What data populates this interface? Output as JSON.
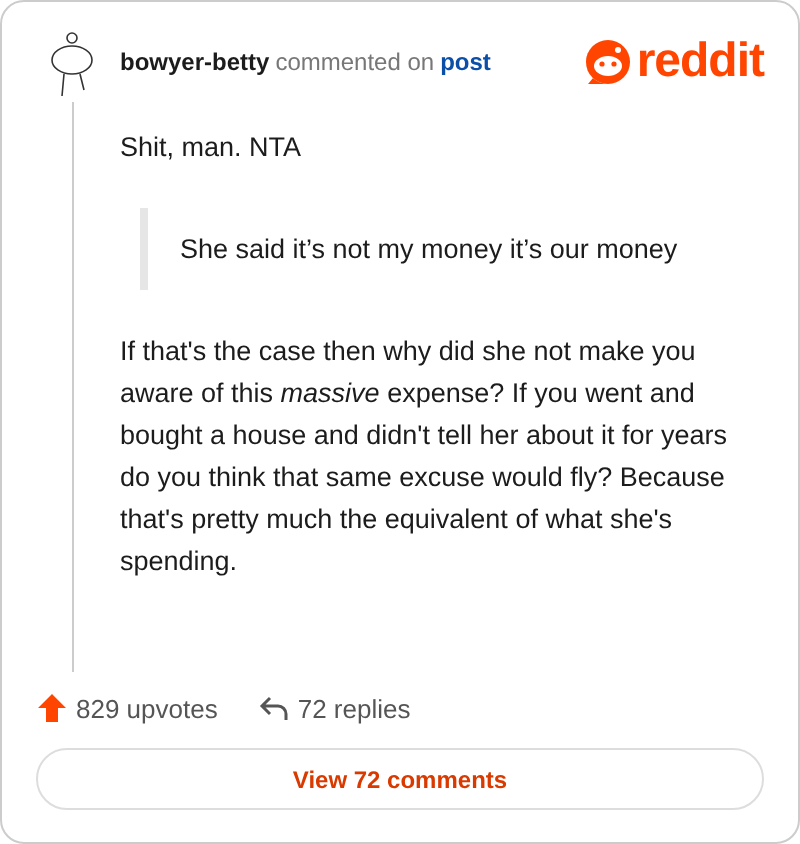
{
  "header": {
    "author": "bowyer-betty",
    "action": "commented on",
    "link": "post",
    "logo": "reddit"
  },
  "body": [
    {
      "kind": "paragraph",
      "text": "Shit, man. NTA"
    },
    {
      "kind": "quote",
      "text": "She said it’s not my money it’s our money"
    },
    {
      "kind": "paragraph",
      "text": "If that's the case then why did she not make you aware of this *massive* expense? If you went and bought a house and didn't tell her about it for years do you think that same excuse would fly? Because that's pretty much the equivalent of what she's spending."
    }
  ],
  "footer": {
    "upvotes": "829 upvotes",
    "replies": "72 replies",
    "button": "View 72 comments"
  }
}
